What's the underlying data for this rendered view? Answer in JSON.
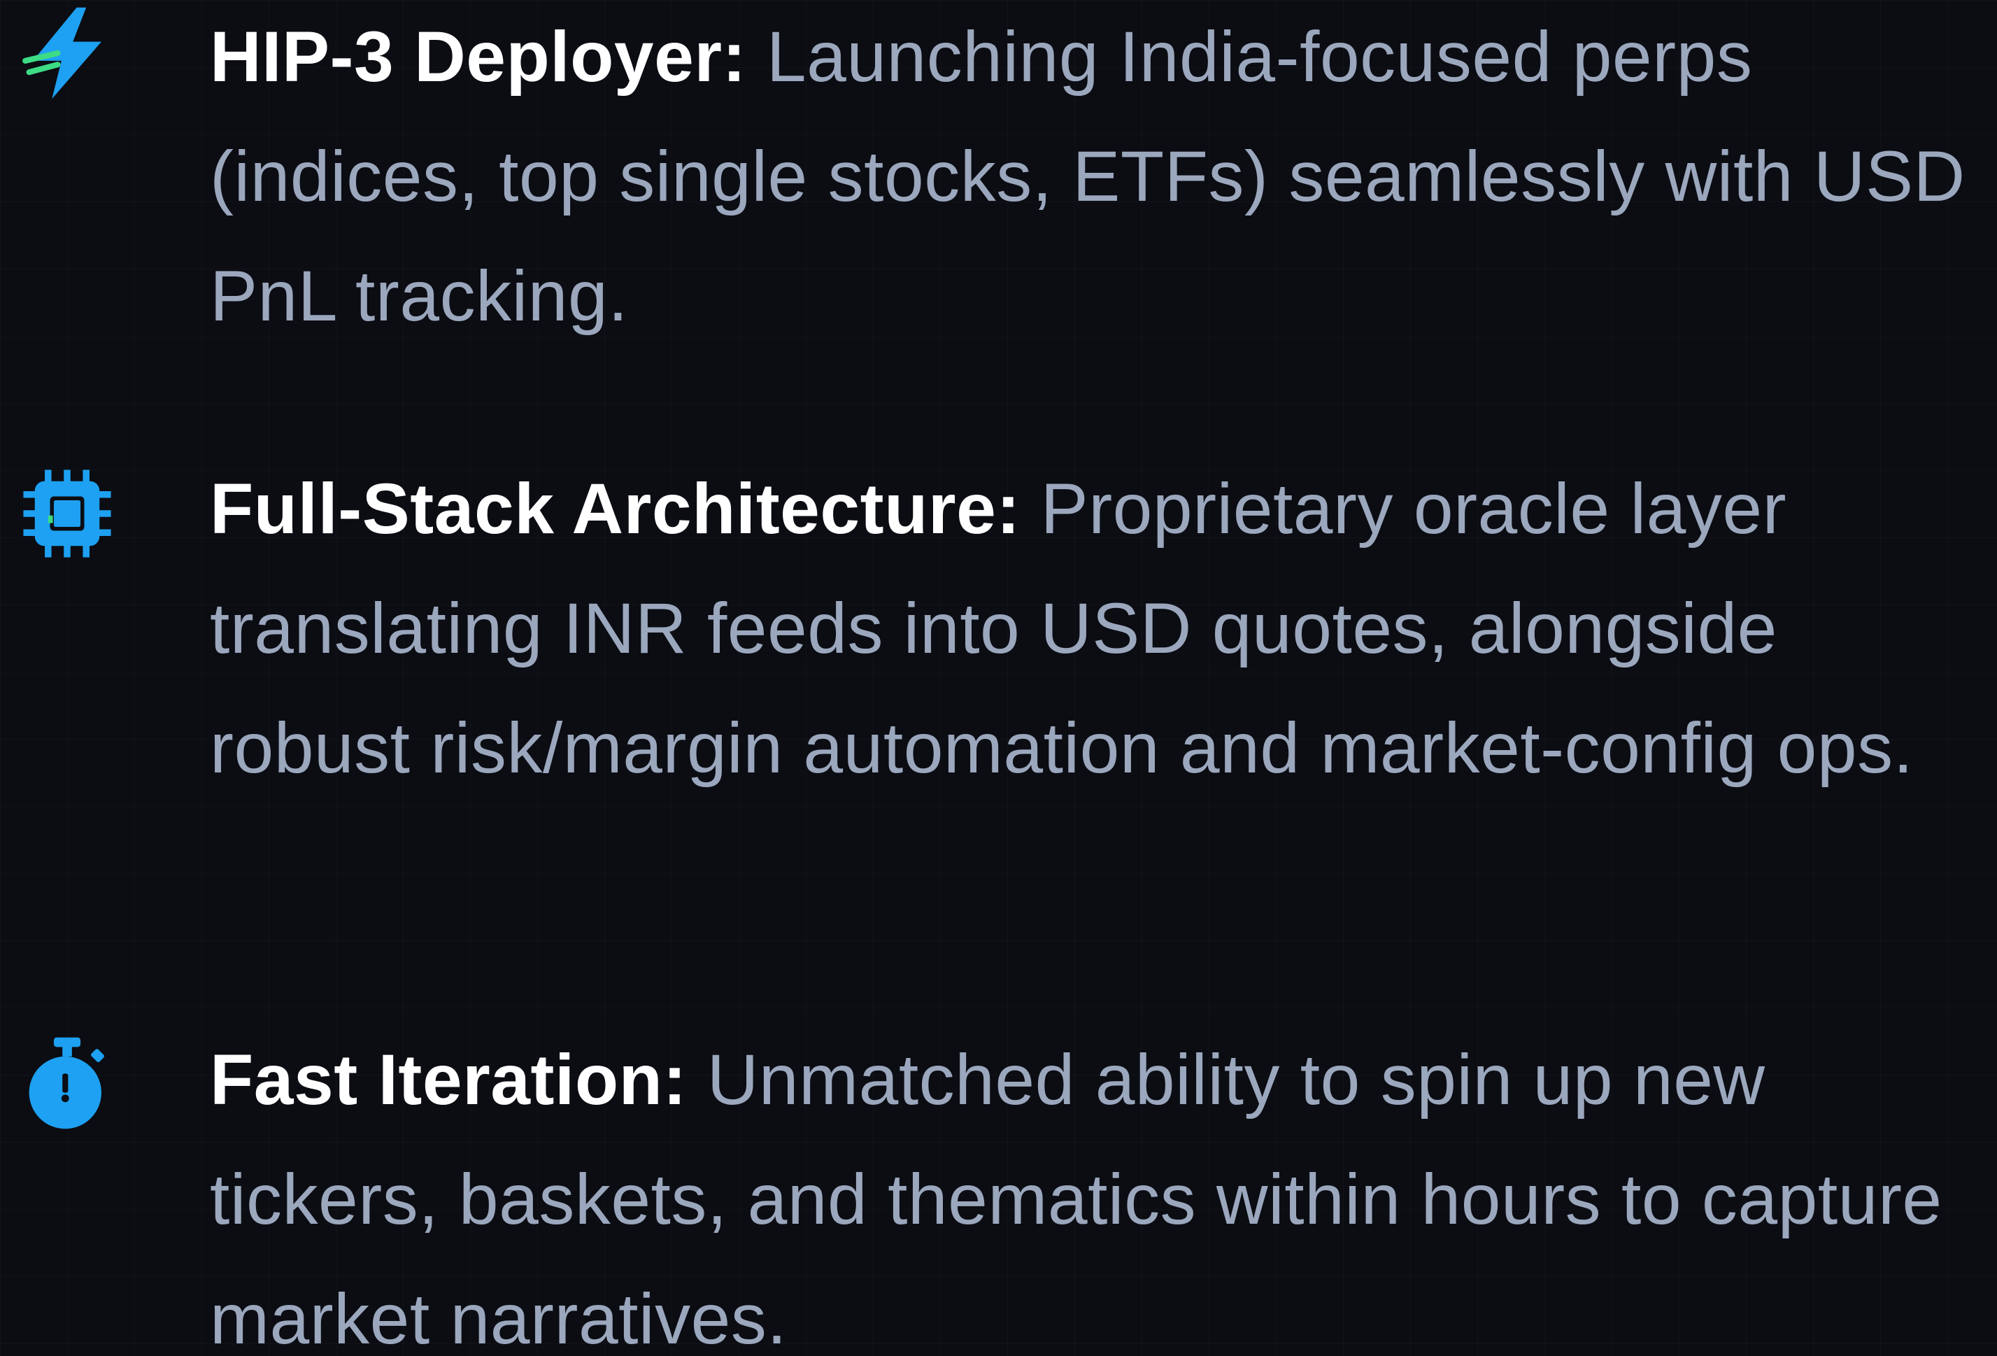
{
  "features": [
    {
      "icon": "lightning-bolt-icon",
      "label": "HIP-3 Deployer:",
      "description": "Launching India-focused perps (indices, top single stocks, ETFs) seamlessly with USD PnL tracking."
    },
    {
      "icon": "cpu-chip-icon",
      "label": "Full-Stack Architecture:",
      "description": "Proprietary oracle layer translating INR feeds into USD quotes, alongside robust risk/margin automation and market-config ops."
    },
    {
      "icon": "stopwatch-icon",
      "label": "Fast Iteration:",
      "description": "Unmatched ability to spin up new tickers, baskets, and thematics within hours to capture market narratives."
    }
  ],
  "colors": {
    "background": "#0b0d13",
    "label": "#ffffff",
    "description": "#9ba7bd",
    "icon_blue": "#1ea1f2",
    "icon_green": "#3ddc84"
  }
}
